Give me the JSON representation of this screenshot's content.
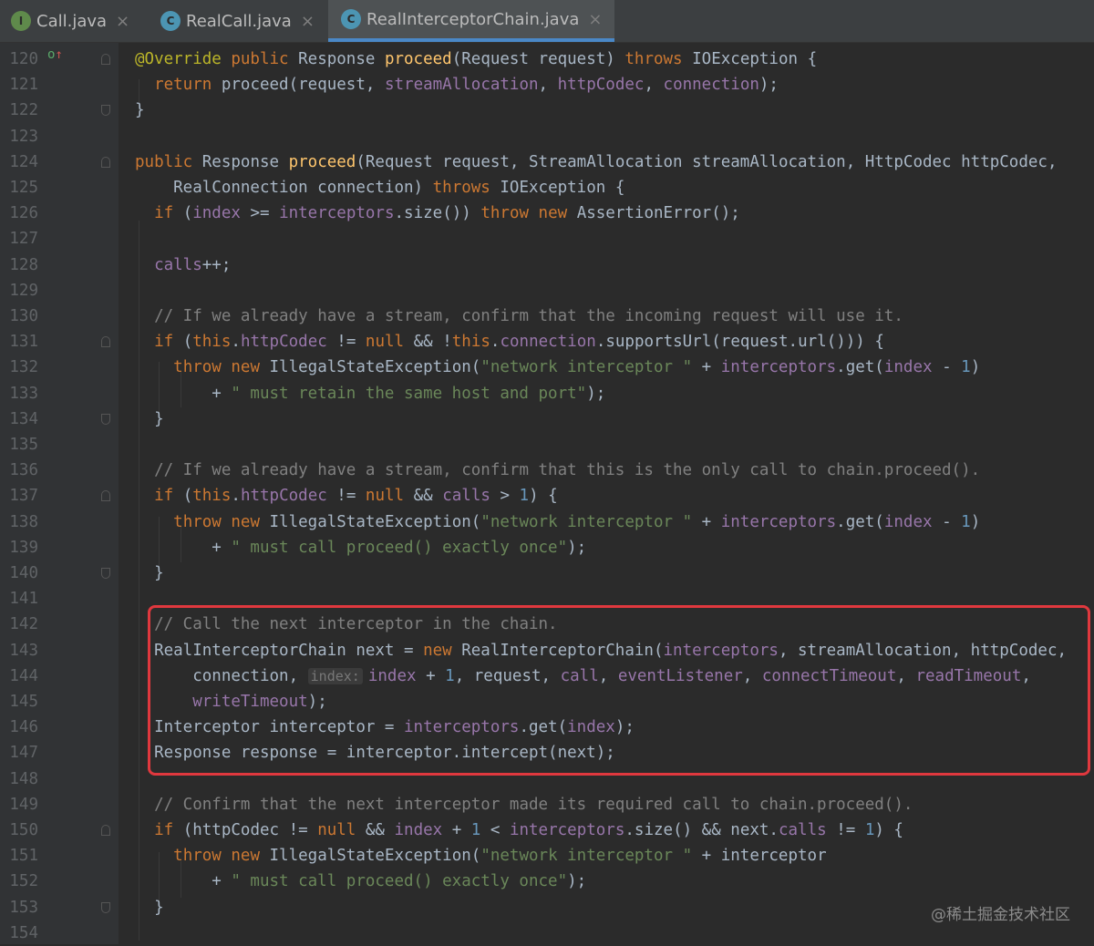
{
  "tabs": [
    {
      "label": "Call.java",
      "icon": "interface-icon",
      "icon_letter": "I",
      "active": false
    },
    {
      "label": "RealCall.java",
      "icon": "class-icon",
      "icon_letter": "C",
      "active": false
    },
    {
      "label": "RealInterceptorChain.java",
      "icon": "class-icon",
      "icon_letter": "C",
      "active": true
    }
  ],
  "tab_close_glyph": "×",
  "gutter_marks": {
    "override_icon": "o",
    "arrow_icon": "↑"
  },
  "colors": {
    "background": "#2b2b2b",
    "keyword": "#cc7832",
    "annotation": "#bbb529",
    "method": "#ffc66d",
    "field": "#9876aa",
    "number": "#6897bb",
    "string": "#6a8759",
    "comment": "#808080",
    "highlight_border": "#e0383e",
    "active_tab_underline": "#4a88c7"
  },
  "code_lines": [
    {
      "n": "120",
      "t": [
        [
          "ann",
          "@Override "
        ],
        [
          "kw",
          "public "
        ],
        [
          "",
          "Response "
        ],
        [
          "fn",
          "proceed"
        ],
        [
          "",
          "(Request request) "
        ],
        [
          "kw",
          "throws "
        ],
        [
          "",
          "IOException {"
        ]
      ]
    },
    {
      "n": "121",
      "t": [
        [
          "",
          "  "
        ],
        [
          "kw",
          "return "
        ],
        [
          "",
          "proceed(request, "
        ],
        [
          "fld",
          "streamAllocation"
        ],
        [
          "",
          ", "
        ],
        [
          "fld",
          "httpCodec"
        ],
        [
          "",
          ", "
        ],
        [
          "fld",
          "connection"
        ],
        [
          "",
          ");"
        ]
      ]
    },
    {
      "n": "122",
      "t": [
        [
          "",
          "}"
        ]
      ]
    },
    {
      "n": "123",
      "t": []
    },
    {
      "n": "124",
      "t": [
        [
          "kw",
          "public "
        ],
        [
          "",
          "Response "
        ],
        [
          "fn",
          "proceed"
        ],
        [
          "",
          "(Request request, StreamAllocation streamAllocation, HttpCodec httpCodec,"
        ]
      ]
    },
    {
      "n": "125",
      "t": [
        [
          "",
          "    RealConnection connection) "
        ],
        [
          "kw",
          "throws "
        ],
        [
          "",
          "IOException {"
        ]
      ]
    },
    {
      "n": "126",
      "t": [
        [
          "",
          "  "
        ],
        [
          "kw",
          "if "
        ],
        [
          "",
          "("
        ],
        [
          "fld",
          "index"
        ],
        [
          "",
          " >= "
        ],
        [
          "fld",
          "interceptors"
        ],
        [
          "",
          ".size()) "
        ],
        [
          "kw",
          "throw new "
        ],
        [
          "",
          "AssertionError();"
        ]
      ]
    },
    {
      "n": "127",
      "t": []
    },
    {
      "n": "128",
      "t": [
        [
          "",
          "  "
        ],
        [
          "fld",
          "calls"
        ],
        [
          "",
          "++;"
        ]
      ]
    },
    {
      "n": "129",
      "t": []
    },
    {
      "n": "130",
      "t": [
        [
          "",
          "  "
        ],
        [
          "cmt",
          "// If we already have a stream, confirm that the incoming request will use it."
        ]
      ]
    },
    {
      "n": "131",
      "t": [
        [
          "",
          "  "
        ],
        [
          "kw",
          "if "
        ],
        [
          "",
          "("
        ],
        [
          "kw",
          "this"
        ],
        [
          "",
          "."
        ],
        [
          "fld",
          "httpCodec"
        ],
        [
          "",
          " != "
        ],
        [
          "kw",
          "null "
        ],
        [
          "",
          "&& !"
        ],
        [
          "kw",
          "this"
        ],
        [
          "",
          "."
        ],
        [
          "fld",
          "connection"
        ],
        [
          "",
          ".supportsUrl(request.url())) {"
        ]
      ]
    },
    {
      "n": "132",
      "t": [
        [
          "",
          "    "
        ],
        [
          "kw",
          "throw new "
        ],
        [
          "",
          "IllegalStateException("
        ],
        [
          "str",
          "\"network interceptor \""
        ],
        [
          "",
          " + "
        ],
        [
          "fld",
          "interceptors"
        ],
        [
          "",
          ".get("
        ],
        [
          "fld",
          "index"
        ],
        [
          "",
          " - "
        ],
        [
          "num",
          "1"
        ],
        [
          "",
          ")"
        ]
      ]
    },
    {
      "n": "133",
      "t": [
        [
          "",
          "        + "
        ],
        [
          "str",
          "\" must retain the same host and port\""
        ],
        [
          "",
          ");"
        ]
      ]
    },
    {
      "n": "134",
      "t": [
        [
          "",
          "  }"
        ]
      ]
    },
    {
      "n": "135",
      "t": []
    },
    {
      "n": "136",
      "t": [
        [
          "",
          "  "
        ],
        [
          "cmt",
          "// If we already have a stream, confirm that this is the only call to chain.proceed()."
        ]
      ]
    },
    {
      "n": "137",
      "t": [
        [
          "",
          "  "
        ],
        [
          "kw",
          "if "
        ],
        [
          "",
          "("
        ],
        [
          "kw",
          "this"
        ],
        [
          "",
          "."
        ],
        [
          "fld",
          "httpCodec"
        ],
        [
          "",
          " != "
        ],
        [
          "kw",
          "null "
        ],
        [
          "",
          "&& "
        ],
        [
          "fld",
          "calls"
        ],
        [
          "",
          " > "
        ],
        [
          "num",
          "1"
        ],
        [
          "",
          ") {"
        ]
      ]
    },
    {
      "n": "138",
      "t": [
        [
          "",
          "    "
        ],
        [
          "kw",
          "throw new "
        ],
        [
          "",
          "IllegalStateException("
        ],
        [
          "str",
          "\"network interceptor \""
        ],
        [
          "",
          " + "
        ],
        [
          "fld",
          "interceptors"
        ],
        [
          "",
          ".get("
        ],
        [
          "fld",
          "index"
        ],
        [
          "",
          " - "
        ],
        [
          "num",
          "1"
        ],
        [
          "",
          ")"
        ]
      ]
    },
    {
      "n": "139",
      "t": [
        [
          "",
          "        + "
        ],
        [
          "str",
          "\" must call proceed() exactly once\""
        ],
        [
          "",
          ");"
        ]
      ]
    },
    {
      "n": "140",
      "t": [
        [
          "",
          "  }"
        ]
      ]
    },
    {
      "n": "141",
      "t": []
    },
    {
      "n": "142",
      "t": [
        [
          "",
          "  "
        ],
        [
          "cmt",
          "// Call the next interceptor in the chain."
        ]
      ]
    },
    {
      "n": "143",
      "t": [
        [
          "",
          "  RealInterceptorChain next = "
        ],
        [
          "kw",
          "new "
        ],
        [
          "",
          "RealInterceptorChain("
        ],
        [
          "fld",
          "interceptors"
        ],
        [
          "",
          ", streamAllocation, httpCodec,"
        ]
      ]
    },
    {
      "n": "144",
      "t": [
        [
          "",
          "      connection, "
        ],
        [
          "hint",
          "index:"
        ],
        [
          "fld",
          "index"
        ],
        [
          "",
          " + "
        ],
        [
          "num",
          "1"
        ],
        [
          "",
          ", request, "
        ],
        [
          "fld",
          "call"
        ],
        [
          "",
          ", "
        ],
        [
          "fld",
          "eventListener"
        ],
        [
          "",
          ", "
        ],
        [
          "fld",
          "connectTimeout"
        ],
        [
          "",
          ", "
        ],
        [
          "fld",
          "readTimeout"
        ],
        [
          "",
          ","
        ]
      ]
    },
    {
      "n": "145",
      "t": [
        [
          "",
          "      "
        ],
        [
          "fld",
          "writeTimeout"
        ],
        [
          "",
          ");"
        ]
      ]
    },
    {
      "n": "146",
      "t": [
        [
          "",
          "  Interceptor interceptor = "
        ],
        [
          "fld",
          "interceptors"
        ],
        [
          "",
          ".get("
        ],
        [
          "fld",
          "index"
        ],
        [
          "",
          ");"
        ]
      ]
    },
    {
      "n": "147",
      "t": [
        [
          "",
          "  Response response = interceptor.intercept(next);"
        ]
      ]
    },
    {
      "n": "148",
      "t": []
    },
    {
      "n": "149",
      "t": [
        [
          "",
          "  "
        ],
        [
          "cmt",
          "// Confirm that the next interceptor made its required call to chain.proceed()."
        ]
      ]
    },
    {
      "n": "150",
      "t": [
        [
          "",
          "  "
        ],
        [
          "kw",
          "if "
        ],
        [
          "",
          "(httpCodec != "
        ],
        [
          "kw",
          "null "
        ],
        [
          "",
          "&& "
        ],
        [
          "fld",
          "index"
        ],
        [
          "",
          " + "
        ],
        [
          "num",
          "1"
        ],
        [
          "",
          " < "
        ],
        [
          "fld",
          "interceptors"
        ],
        [
          "",
          ".size() && next."
        ],
        [
          "fld",
          "calls"
        ],
        [
          "",
          " != "
        ],
        [
          "num",
          "1"
        ],
        [
          "",
          ") {"
        ]
      ]
    },
    {
      "n": "151",
      "t": [
        [
          "",
          "    "
        ],
        [
          "kw",
          "throw new "
        ],
        [
          "",
          "IllegalStateException("
        ],
        [
          "str",
          "\"network interceptor \""
        ],
        [
          "",
          " + interceptor"
        ]
      ]
    },
    {
      "n": "152",
      "t": [
        [
          "",
          "        + "
        ],
        [
          "str",
          "\" must call proceed() exactly once\""
        ],
        [
          "",
          ");"
        ]
      ]
    },
    {
      "n": "153",
      "t": [
        [
          "",
          "  }"
        ]
      ]
    },
    {
      "n": "154",
      "t": []
    }
  ],
  "watermark": "@稀土掘金技术社区"
}
